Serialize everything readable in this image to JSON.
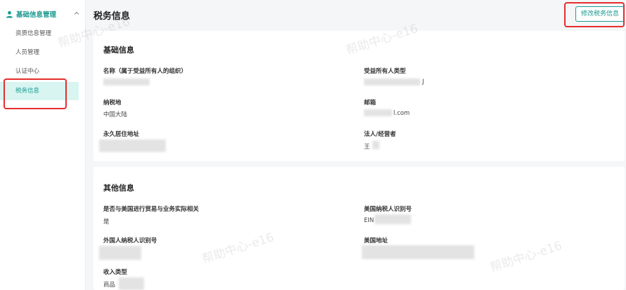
{
  "sidebar": {
    "group_title": "基础信息管理",
    "items": [
      {
        "label": "资质信息管理"
      },
      {
        "label": "人员管理"
      },
      {
        "label": "认证中心"
      },
      {
        "label": "税务信息"
      }
    ]
  },
  "header": {
    "title": "税务信息",
    "edit_button": "修改税务信息"
  },
  "basic_info": {
    "title": "基础信息",
    "fields": [
      {
        "label": "名称（属于受益所有人的组织）",
        "value": ""
      },
      {
        "label": "受益所有人类型",
        "value": "J"
      },
      {
        "label": "纳税地",
        "value": "中国大陆"
      },
      {
        "label": "邮箱",
        "value": "l.com"
      },
      {
        "label": "永久居住地址",
        "value": ""
      },
      {
        "label": "法人/经营者",
        "value": "王"
      }
    ]
  },
  "other_info": {
    "title": "其他信息",
    "fields": [
      {
        "label": "是否与美国进行贸易与业务实际相关",
        "value": "是"
      },
      {
        "label": "美国纳税人识别号",
        "value": "EIN"
      },
      {
        "label": "外国人纳税人识别号",
        "value": ""
      },
      {
        "label": "美国地址",
        "value": ""
      },
      {
        "label": "收入类型",
        "value": "商品"
      }
    ]
  },
  "watermark_text": "帮助中心-e16",
  "colors": {
    "accent": "#1a9a90",
    "highlight": "#e62d2d",
    "active_bg": "#d8f5f2"
  }
}
